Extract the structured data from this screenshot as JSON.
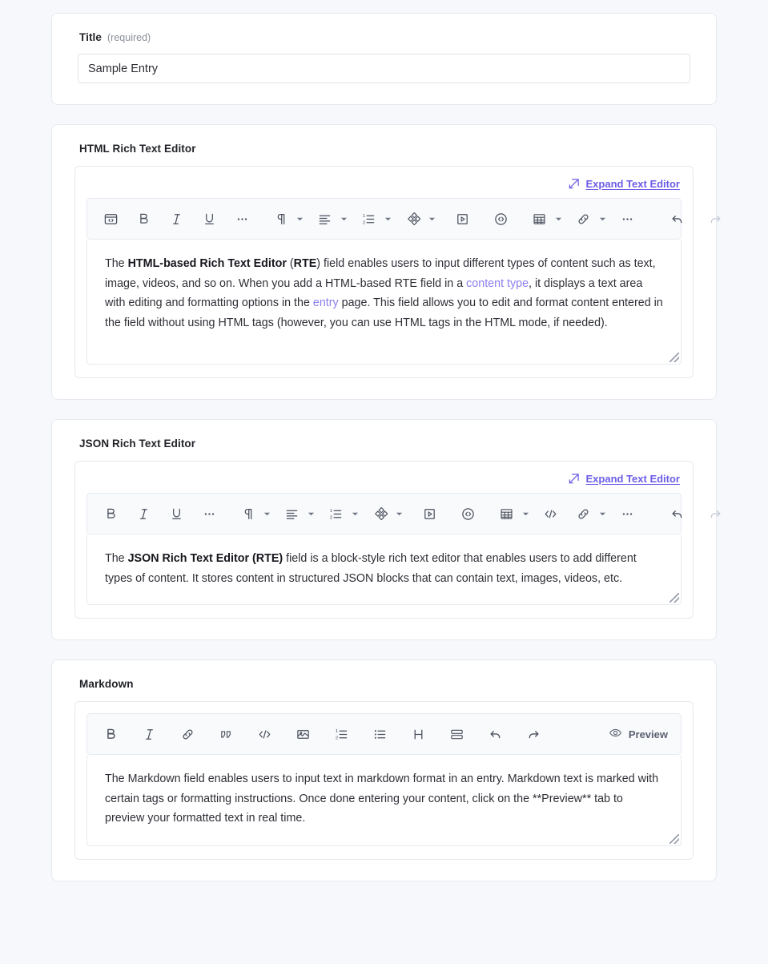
{
  "title_field": {
    "label": "Title",
    "required_note": "(required)",
    "value": "Sample Entry",
    "placeholder": ""
  },
  "html_rte": {
    "section_label": "HTML Rich Text Editor",
    "expand_link": "Expand Text Editor",
    "toolbar": [
      {
        "name": "embed-code-icon",
        "label": "Embed code"
      },
      {
        "name": "bold-icon",
        "label": "Bold"
      },
      {
        "name": "italic-icon",
        "label": "Italic"
      },
      {
        "name": "underline-icon",
        "label": "Underline"
      },
      {
        "name": "more-formatting-icon",
        "label": "More"
      },
      {
        "name": "paragraph-icon",
        "label": "Paragraph",
        "caret": true
      },
      {
        "name": "align-left-icon",
        "label": "Alignment",
        "caret": true
      },
      {
        "name": "ordered-list-icon",
        "label": "Lists",
        "caret": true
      },
      {
        "name": "asset-icon",
        "label": "Assets",
        "caret": true
      },
      {
        "name": "video-embed-icon",
        "label": "Video"
      },
      {
        "name": "code-circle-icon",
        "label": "Code block"
      },
      {
        "name": "table-icon",
        "label": "Table",
        "caret": true
      },
      {
        "name": "link-icon",
        "label": "Link",
        "caret": true
      },
      {
        "name": "more-options-icon",
        "label": "More options"
      },
      {
        "name": "undo-icon",
        "label": "Undo"
      },
      {
        "name": "redo-icon",
        "label": "Redo",
        "disabled": true
      }
    ],
    "body": {
      "t1": "The ",
      "b1": "HTML-based Rich Text Editor",
      "t2": " (",
      "b2": "RTE",
      "t3": ") field enables users to input different types of content such as text, image, videos, and so on. When you add a HTML-based RTE field in a ",
      "link1": "content type",
      "t4": ", it displays a text area with editing and formatting options in the ",
      "link2": "entry",
      "t5": " page. This field allows you to edit and format content entered in the field without using HTML tags (however, you can use HTML tags in the HTML mode, if needed)."
    }
  },
  "json_rte": {
    "section_label": "JSON Rich Text Editor",
    "expand_link": "Expand Text Editor",
    "toolbar": [
      {
        "name": "bold-icon",
        "label": "Bold"
      },
      {
        "name": "italic-icon",
        "label": "Italic"
      },
      {
        "name": "underline-icon",
        "label": "Underline"
      },
      {
        "name": "more-formatting-icon",
        "label": "More"
      },
      {
        "name": "paragraph-icon",
        "label": "Paragraph",
        "caret": true
      },
      {
        "name": "align-left-icon",
        "label": "Alignment",
        "caret": true
      },
      {
        "name": "ordered-list-icon",
        "label": "Lists",
        "caret": true
      },
      {
        "name": "asset-icon",
        "label": "Assets",
        "caret": true
      },
      {
        "name": "video-embed-icon",
        "label": "Video"
      },
      {
        "name": "code-circle-icon",
        "label": "Code block"
      },
      {
        "name": "table-icon",
        "label": "Table",
        "caret": true
      },
      {
        "name": "inline-code-icon",
        "label": "Inline code"
      },
      {
        "name": "link-icon",
        "label": "Link",
        "caret": true
      },
      {
        "name": "more-options-icon",
        "label": "More options"
      },
      {
        "name": "undo-icon",
        "label": "Undo"
      },
      {
        "name": "redo-icon",
        "label": "Redo",
        "disabled": true
      }
    ],
    "body": {
      "t1": "The ",
      "b1": "JSON Rich Text Editor (RTE)",
      "t2": " field is a block-style rich text editor that enables users to add different types of content. It stores content in structured JSON blocks that can contain text, images, videos, etc."
    }
  },
  "markdown": {
    "section_label": "Markdown",
    "preview_label": "Preview",
    "toolbar": [
      {
        "name": "bold-icon",
        "label": "Bold"
      },
      {
        "name": "italic-icon",
        "label": "Italic"
      },
      {
        "name": "link-icon",
        "label": "Link"
      },
      {
        "name": "quote-icon",
        "label": "Quote"
      },
      {
        "name": "code-icon",
        "label": "Code"
      },
      {
        "name": "image-icon",
        "label": "Image"
      },
      {
        "name": "ordered-list-icon",
        "label": "Ordered list"
      },
      {
        "name": "bullet-list-icon",
        "label": "Bullet list"
      },
      {
        "name": "heading-icon",
        "label": "Heading"
      },
      {
        "name": "horizontal-rule-icon",
        "label": "Horizontal rule"
      },
      {
        "name": "undo-icon",
        "label": "Undo"
      },
      {
        "name": "redo-icon",
        "label": "Redo"
      }
    ],
    "body": {
      "t1": "The Markdown field enables users to input text in markdown format in an entry. Markdown text is marked with certain tags or formatting instructions. Once done entering your content, click on the **Preview** tab to preview your formatted text in real time."
    }
  },
  "colors": {
    "page_bg": "#f6f8fb",
    "card_bg": "#ffffff",
    "border": "#e6eaf0",
    "toolbar_bg": "#f9fafc",
    "accent_link": "#6c5ce7",
    "inline_link": "#8b7ff0",
    "icon": "#4a4f5c",
    "icon_disabled": "#c6cbd6"
  }
}
